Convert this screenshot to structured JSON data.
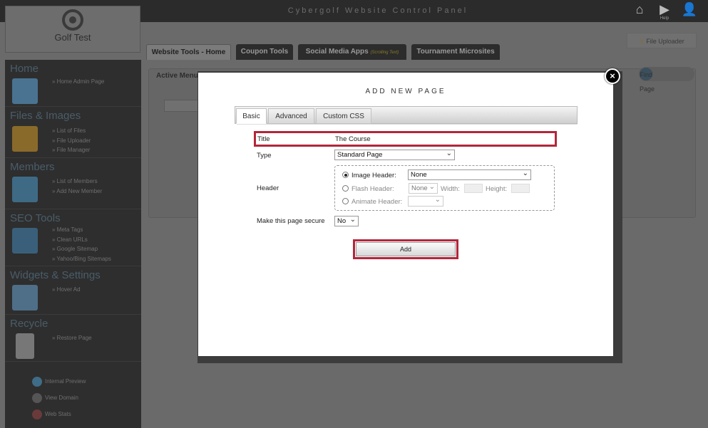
{
  "topbar": {
    "title": "Cybergolf Website Control Panel",
    "help_label": "Help"
  },
  "logo": {
    "name": "Golf Test"
  },
  "sidebar": {
    "sections": [
      {
        "title": "Home",
        "links": [
          "Home Admin Page"
        ]
      },
      {
        "title": "Files & Images",
        "links": [
          "List of Files",
          "File Uploader",
          "File Manager"
        ]
      },
      {
        "title": "Members",
        "links": [
          "List of Members",
          "Add New Member"
        ]
      },
      {
        "title": "SEO Tools",
        "links": [
          "Meta Tags",
          "Clean URLs",
          "Google Sitemap",
          "Yahoo/Bing Sitemaps"
        ]
      },
      {
        "title": "Widgets & Settings",
        "links": [
          "Hover Ad"
        ]
      },
      {
        "title": "Recycle",
        "links": [
          "Restore Page"
        ]
      }
    ],
    "footer": [
      "Internal Preview",
      "View Domain",
      "Web Stats"
    ]
  },
  "main": {
    "tabs": [
      "Website Tools - Home",
      "Coupon Tools",
      "Social Media Apps",
      "Tournament Microsites"
    ],
    "social_tag": "(Scrolling Text)",
    "file_uploader": "File Uploader",
    "active_menu": "Active Menu",
    "find_page": "Find Page"
  },
  "modal": {
    "title": "ADD NEW PAGE",
    "close": "×",
    "tabs": [
      "Basic",
      "Advanced",
      "Custom CSS"
    ],
    "title_label": "Title",
    "title_value": "The Course",
    "type_label": "Type",
    "type_value": "Standard Page",
    "header_label": "Header",
    "image_header_label": "Image Header:",
    "image_header_value": "None",
    "flash_header_label": "Flash Header:",
    "flash_header_value": "None",
    "width_label": "Width:",
    "height_label": "Height:",
    "animate_header_label": "Animate Header:",
    "secure_label": "Make this page secure",
    "secure_value": "No",
    "add_button": "Add"
  },
  "colors": {
    "highlight": "#b3263a",
    "sidebar_heading": "#4a5d6a"
  }
}
